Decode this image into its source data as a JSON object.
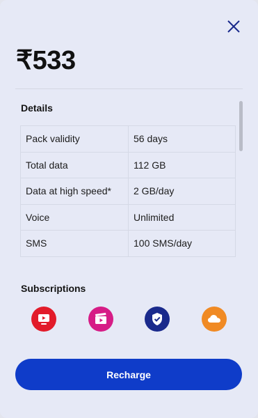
{
  "plan": {
    "price": "₹533"
  },
  "details": {
    "title": "Details",
    "rows": [
      {
        "label": "Pack validity",
        "value": "56 days"
      },
      {
        "label": "Total data",
        "value": "112 GB"
      },
      {
        "label": "Data at high speed*",
        "value": "2 GB/day"
      },
      {
        "label": "Voice",
        "value": "Unlimited"
      },
      {
        "label": "SMS",
        "value": "100 SMS/day"
      }
    ]
  },
  "subscriptions": {
    "title": "Subscriptions",
    "items": [
      {
        "icon": "tv-app-icon",
        "color": "#e21b2a"
      },
      {
        "icon": "cinema-app-icon",
        "color": "#d61c86"
      },
      {
        "icon": "security-shield-icon",
        "color": "#1a2a8c"
      },
      {
        "icon": "cloud-app-icon",
        "color": "#f08a24"
      }
    ]
  },
  "actions": {
    "recharge_label": "Recharge"
  },
  "colors": {
    "accent": "#0f3cc9",
    "background": "#e6e9f6"
  }
}
